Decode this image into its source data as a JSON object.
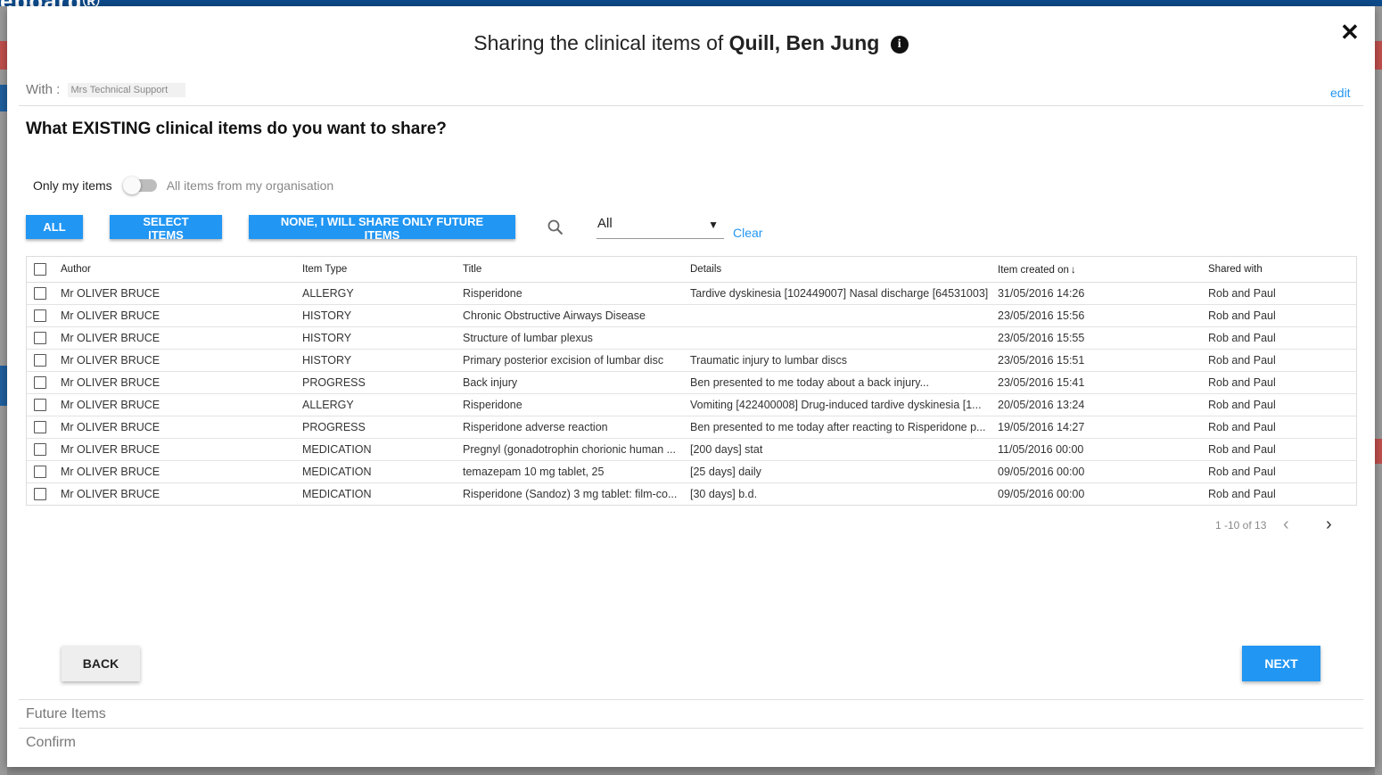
{
  "background": {
    "logo_text": "eboard®"
  },
  "dialog": {
    "title_prefix": "Sharing the clinical items of",
    "patient_name": "Quill, Ben Jung",
    "info_icon": "i",
    "close_icon": "✕"
  },
  "with": {
    "label": "With :",
    "recipient": "Mrs Technical Support",
    "edit_label": "edit"
  },
  "question": "What EXISTING clinical items do you want to share?",
  "scope_toggle": {
    "left_label": "Only my items",
    "right_label": "All items from my organisation",
    "on": false
  },
  "actions": {
    "all_label": "ALL",
    "select_label": "SELECT ITEMS",
    "none_label": "NONE, I WILL SHARE ONLY FUTURE ITEMS"
  },
  "filter": {
    "selected": "All",
    "clear_label": "Clear"
  },
  "table": {
    "headers": {
      "author": "Author",
      "item_type": "Item Type",
      "title": "Title",
      "details": "Details",
      "created": "Item created on",
      "shared": "Shared with"
    },
    "rows": [
      {
        "author": "Mr OLIVER BRUCE",
        "type": "ALLERGY",
        "title": "Risperidone",
        "details": "Tardive dyskinesia [102449007] Nasal discharge [64531003]",
        "created": "31/05/2016 14:26",
        "shared": "Rob and Paul"
      },
      {
        "author": "Mr OLIVER BRUCE",
        "type": "HISTORY",
        "title": "Chronic Obstructive Airways Disease",
        "details": "",
        "created": "23/05/2016 15:56",
        "shared": "Rob and Paul"
      },
      {
        "author": "Mr OLIVER BRUCE",
        "type": "HISTORY",
        "title": "Structure of lumbar plexus",
        "details": "",
        "created": "23/05/2016 15:55",
        "shared": "Rob and Paul"
      },
      {
        "author": "Mr OLIVER BRUCE",
        "type": "HISTORY",
        "title": "Primary posterior excision of lumbar disc",
        "details": "Traumatic injury to lumbar discs",
        "created": "23/05/2016 15:51",
        "shared": "Rob and Paul"
      },
      {
        "author": "Mr OLIVER BRUCE",
        "type": "PROGRESS",
        "title": "Back injury",
        "details": "Ben presented to me today about a back injury...",
        "created": "23/05/2016 15:41",
        "shared": "Rob and Paul"
      },
      {
        "author": "Mr OLIVER BRUCE",
        "type": "ALLERGY",
        "title": "Risperidone",
        "details": "Vomiting [422400008] Drug-induced tardive dyskinesia [1...",
        "created": "20/05/2016 13:24",
        "shared": "Rob and Paul"
      },
      {
        "author": "Mr OLIVER BRUCE",
        "type": "PROGRESS",
        "title": "Risperidone adverse reaction",
        "details": "Ben presented to me today after reacting to Risperidone p...",
        "created": "19/05/2016 14:27",
        "shared": "Rob and Paul"
      },
      {
        "author": "Mr OLIVER BRUCE",
        "type": "MEDICATION",
        "title": "Pregnyl (gonadotrophin chorionic human ...",
        "details": "[200 days] stat",
        "created": "11/05/2016 00:00",
        "shared": "Rob and Paul"
      },
      {
        "author": "Mr OLIVER BRUCE",
        "type": "MEDICATION",
        "title": "temazepam 10 mg tablet, 25",
        "details": "[25 days] daily",
        "created": "09/05/2016 00:00",
        "shared": "Rob and Paul"
      },
      {
        "author": "Mr OLIVER BRUCE",
        "type": "MEDICATION",
        "title": "Risperidone (Sandoz) 3 mg tablet: film-co...",
        "details": "[30 days] b.d.",
        "created": "09/05/2016 00:00",
        "shared": "Rob and Paul"
      }
    ]
  },
  "pagination": {
    "text": "1 -10 of 13"
  },
  "nav": {
    "back_label": "BACK",
    "next_label": "NEXT"
  },
  "steps": {
    "future": "Future Items",
    "confirm": "Confirm"
  },
  "colors": {
    "accent": "#2196f3",
    "header_bar": "#0d4a8a"
  }
}
